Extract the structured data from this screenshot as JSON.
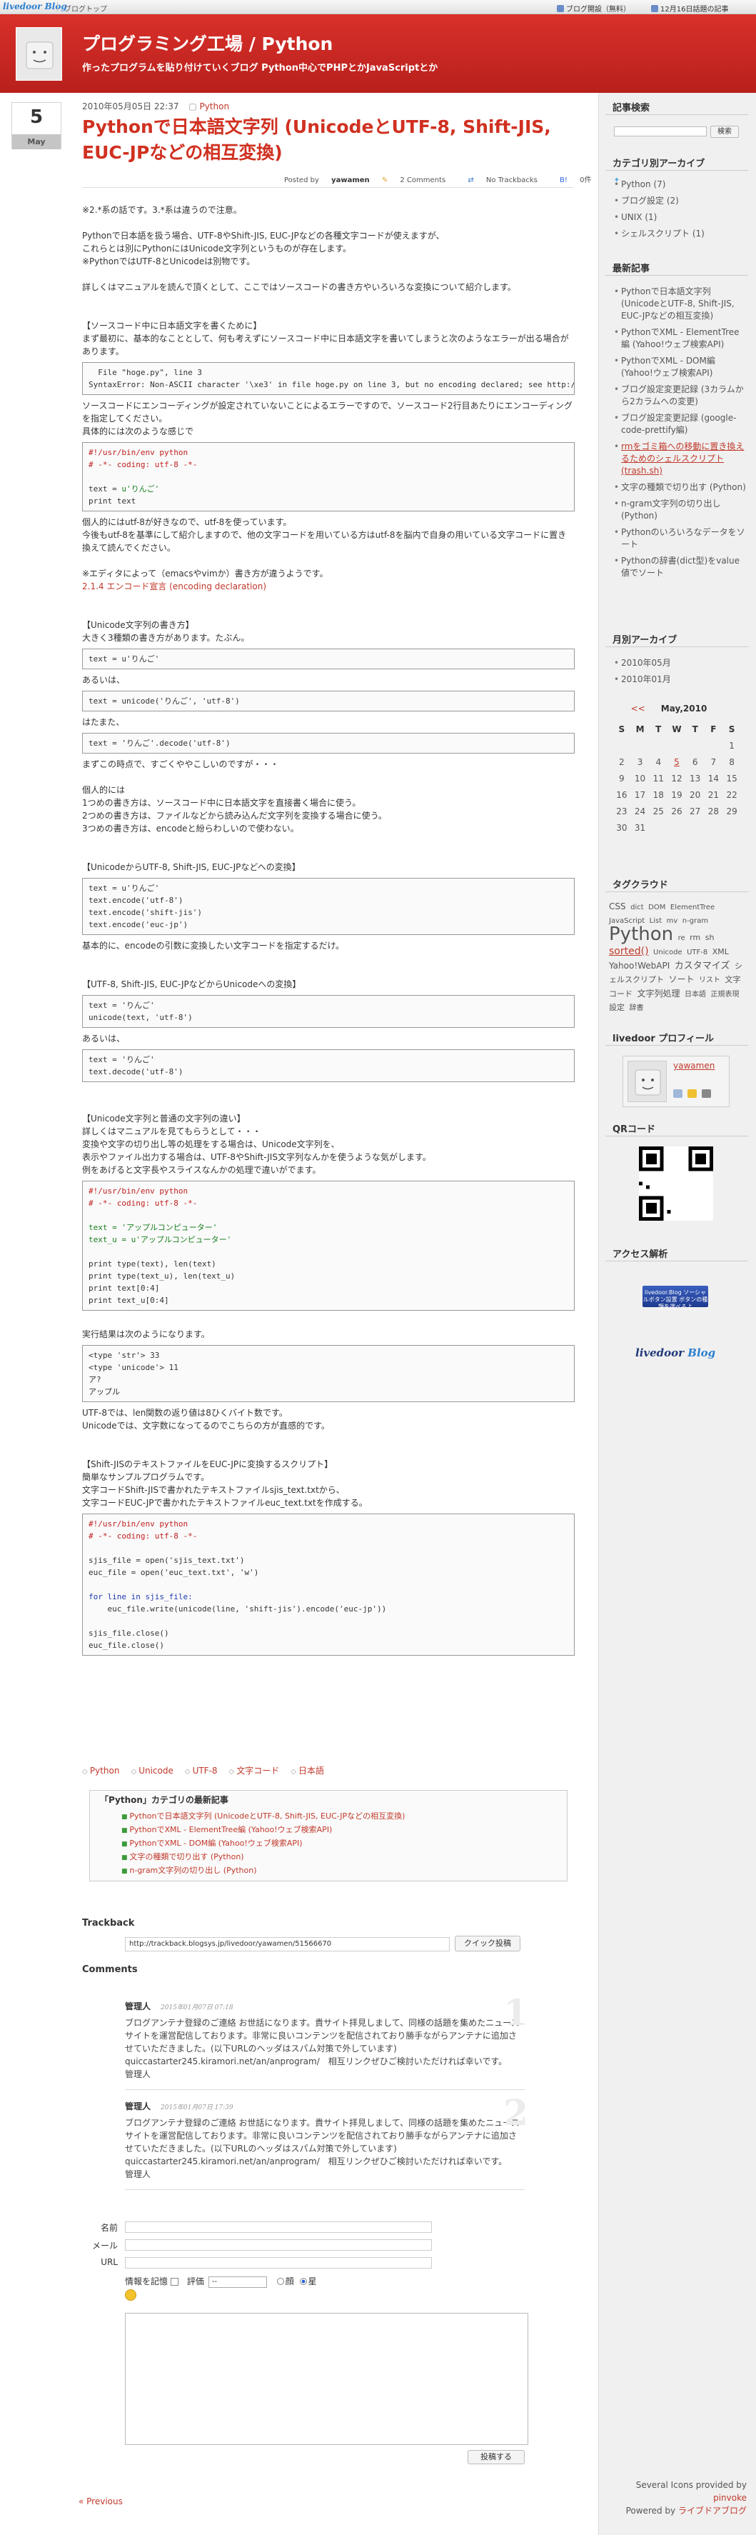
{
  "topbar": {
    "brand_a": "livedoor",
    "brand_b": "Blog",
    "link_left": "ブログトップ",
    "link_signup": "ブログ開設（無料）",
    "link_hot": "12月16日話題の記事"
  },
  "header": {
    "title": "プログラミング工場 / Python",
    "description": "作ったプログラムを貼り付けていくブログ Python中心でPHPとかJavaScriptとか"
  },
  "post": {
    "day": "5",
    "month": "May",
    "datetime": "2010年05月05日 22:37",
    "category": "Python",
    "title": "Pythonで日本語文字列 (UnicodeとUTF-8, Shift-JIS, EUC-JPなどの相互変換)",
    "posted_by_label": "Posted by",
    "author": "yawamen",
    "comments": "2 Comments",
    "trackbacks": "No Trackbacks",
    "users": "0件",
    "intro": "※2.*系の話です。3.*系は違うので注意。\n\nPythonで日本語を扱う場合、UTF-8やShift-JIS, EUC-JPなどの各種文字コードが使えますが、\nこれらとは別にPythonにはUnicode文字列というものが存在します。\n※PythonではUTF-8とUnicodeは別物です。\n\n詳しくはマニュアルを読んで頂くとして、ここではソースコードの書き方やいろいろな変換について紹介します。",
    "s1_head": "【ソースコード中に日本語文字を書くために】\nまず最初に、基本的なこととして、何も考えずにソースコード中に日本語文字を書いてしまうと次のようなエラーが出る場合があります。",
    "s1_code": "  File \"hoge.py\", line 3\nSyntaxError: Non-ASCII character '\\xe3' in file hoge.py on line 3, but no encoding declared; see http://www",
    "s1_mid": "ソースコードにエンコーディングが設定されていないことによるエラーですので、ソースコード2行目あたりにエンコーディングを指定してください。\n具体的には次のような感じで",
    "s1_code2_l1": "#!/usr/bin/env python",
    "s1_code2_l2": "# -*- coding: utf-8 -*-",
    "s1_code2_l3": "text = u'りんご'",
    "s1_code2_l4": "print text",
    "s1_after": "個人的にはutf-8が好きなので、utf-8を使っています。\n今後もutf-8を基準にして紹介しますので、他の文字コードを用いている方はutf-8を脳内で自身の用いている文字コードに置き換えて読んでください。\n\n※エディタによって（emacsやvimか）書き方が違うようです。",
    "s1_link": "2.1.4 エンコード宣言 (encoding declaration)",
    "s2_head": "【Unicode文字列の書き方】\n大きく3種類の書き方があります。たぶん。",
    "s2_code1": "text = u'りんご'",
    "s2_or1": "あるいは、",
    "s2_code2": "text = unicode('りんご', 'utf-8')",
    "s2_or2": "はたまた、",
    "s2_code3": "text = 'りんご'.decode('utf-8')",
    "s2_after": "まずこの時点で、すごくややこしいのですが・・・\n\n個人的には\n1つめの書き方は、ソースコード中に日本語文字を直接書く場合に使う。\n2つめの書き方は、ファイルなどから読み込んだ文字列を変換する場合に使う。\n3つめの書き方は、encodeと紛らわしいので使わない。",
    "s3_head": "【UnicodeからUTF-8, Shift-JIS, EUC-JPなどへの変換】",
    "s3_code_l1": "text = u'りんご'",
    "s3_code_l2": "text.encode('utf-8')",
    "s3_code_l3": "text.encode('shift-jis')",
    "s3_code_l4": "text.encode('euc-jp')",
    "s3_after": "基本的に、encodeの引数に変換したい文字コードを指定するだけ。",
    "s4_head": "【UTF-8, Shift-JIS, EUC-JPなどからUnicodeへの変換】",
    "s4_code1_l1": "text = 'りんご'",
    "s4_code1_l2": "unicode(text, 'utf-8')",
    "s4_or": "あるいは、",
    "s4_code2_l1": "text = 'りんご'",
    "s4_code2_l2": "text.decode('utf-8')",
    "s5_head": "【Unicode文字列と普通の文字列の違い】\n詳しくはマニュアルを見てもらうとして・・・\n変換や文字の切り出し等の処理をする場合は、Unicode文字列を、\n表示やファイル出力する場合は、UTF-8やShift-JIS文字列なんかを使うような気がします。\n例をあげると文字長やスライスなんかの処理で違いがでます。",
    "s5_code_l1": "#!/usr/bin/env python",
    "s5_code_l2": "# -*- coding: utf-8 -*-",
    "s5_code_l3": "text = 'アップルコンピューター'",
    "s5_code_l4": "text_u = u'アップルコンピューター'",
    "s5_code_l5": "print type(text), len(text)",
    "s5_code_l6": "print type(text_u), len(text_u)",
    "s5_code_l7": "print text[0:4]",
    "s5_code_l8": "print text_u[0:4]",
    "s5_result_label": "実行結果は次のようになります。",
    "s5_result": "<type 'str'> 33\n<type 'unicode'> 11\nア?\nアップル",
    "s5_after": "UTF-8では、len関数の返り値は8ひくバイト数です。\nUnicodeでは、文字数になってるのでこちらの方が直感的です。",
    "s6_head": "【Shift-JISのテキストファイルをEUC-JPに変換するスクリプト】\n簡単なサンプルプログラムです。\n文字コードShift-JISで書かれたテキストファイルsjis_text.txtから、\n文字コードEUC-JPで書かれたテキストファイルeuc_text.txtを作成する。",
    "s6_code_l1": "#!/usr/bin/env python",
    "s6_code_l2": "# -*- coding: utf-8 -*-",
    "s6_code_l3": "sjis_file = open('sjis_text.txt')",
    "s6_code_l4": "euc_file = open('euc_text.txt', 'w')",
    "s6_code_l5": "for line in sjis_file:",
    "s6_code_l6": "    euc_file.write(unicode(line, 'shift-jis').encode('euc-jp'))",
    "s6_code_l7": "sjis_file.close()",
    "s6_code_l8": "euc_file.close()"
  },
  "tags": [
    "Python",
    "Unicode",
    "UTF-8",
    "文字コード",
    "日本語"
  ],
  "related": {
    "heading": "「Python」カテゴリの最新記事",
    "items": [
      "Pythonで日本語文字列 (UnicodeとUTF-8, Shift-JIS, EUC-JPなどの相互変換)",
      "PythonでXML - ElementTree編 (Yahoo!ウェブ検索API)",
      "PythonでXML - DOM編 (Yahoo!ウェブ検索API)",
      "文字の種類で切り出す (Python)",
      "n-gram文字列の切り出し (Python)"
    ]
  },
  "trackback": {
    "heading": "Trackback",
    "url": "http://trackback.blogsys.jp/livedoor/yawamen/51566670",
    "button": "クイック投稿"
  },
  "comments": {
    "heading": "Comments",
    "items": [
      {
        "num": "1",
        "name": "管理人",
        "date": "2015年01月07日 07:18",
        "text": "ブログアンテナ登録のご連絡 お世話になります。貴サイト拝見しまして、同様の話題を集めたニュースサイトを運営配信しております。非常に良いコンテンツを配信されており勝手ながらアンテナに追加させていただきました。(以下URLのヘッダはスパム対策で外しています)\nquiccastarter245.kiramori.net/an/anprogram/　相互リンクぜひご検討いただければ幸いです。\n管理人"
      },
      {
        "num": "2",
        "name": "管理人",
        "date": "2015年01月07日 17:39",
        "text": "ブログアンテナ登録のご連絡 お世話になります。貴サイト拝見しまして、同様の話題を集めたニュースサイトを運営配信しております。非常に良いコンテンツを配信されており勝手ながらアンテナに追加させていただきました。(以下URLのヘッダはスパム対策で外しています)\nquiccastarter245.kiramori.net/an/anprogram/　相互リンクぜひご検討いただければ幸いです。\n管理人"
      }
    ]
  },
  "form": {
    "name_label": "名前",
    "email_label": "メール",
    "url_label": "URL",
    "remember_label": "情報を記憶",
    "rating_label": "評価",
    "rating_value": "--",
    "face_good": "顔",
    "face_star": "星",
    "submit": "投稿する"
  },
  "prev_link": "« Previous",
  "sidebar": {
    "search_heading": "記事検索",
    "search_button": "検索",
    "category_heading": "カテゴリ別アーカイブ",
    "categories": [
      "Python (7)",
      "ブログ設定 (2)",
      "UNIX (1)",
      "シェルスクリプト (1)"
    ],
    "recent_heading": "最新記事",
    "recent": [
      "Pythonで日本語文字列 (UnicodeとUTF-8, Shift-JIS, EUC-JPなどの相互変換)",
      "PythonでXML - ElementTree編 (Yahoo!ウェブ検索API)",
      "PythonでXML - DOM編 (Yahoo!ウェブ検索API)",
      "ブログ設定変更記録 (3カラムから2カラムへの変更)",
      "ブログ設定変更記録 (google-code-prettify編)",
      "rmをゴミ箱への移動に置き換えるためのシェルスクリプト (trash.sh)",
      "文字の種類で切り出す (Python)",
      "n-gram文字列の切り出し (Python)",
      "Pythonのいろいろなデータをソート",
      "Pythonの辞書(dict型)をvalue値でソート"
    ],
    "monthly_heading": "月別アーカイブ",
    "months": [
      "2010年05月",
      "2010年01月"
    ],
    "calendar": {
      "prev": "<<",
      "title": "May,2010",
      "days": [
        "S",
        "M",
        "T",
        "W",
        "T",
        "F",
        "S"
      ],
      "weeks": [
        [
          "",
          "",
          "",
          "",
          "",
          "",
          "1"
        ],
        [
          "2",
          "3",
          "4",
          "5",
          "6",
          "7",
          "8"
        ],
        [
          "9",
          "10",
          "11",
          "12",
          "13",
          "14",
          "15"
        ],
        [
          "16",
          "17",
          "18",
          "19",
          "20",
          "21",
          "22"
        ],
        [
          "23",
          "24",
          "25",
          "26",
          "27",
          "28",
          "29"
        ],
        [
          "30",
          "31",
          "",
          "",
          "",
          "",
          ""
        ]
      ],
      "linked": [
        "5"
      ]
    },
    "tagcloud_heading": "タグクラウド",
    "tagcloud": [
      {
        "t": "CSS",
        "s": 12
      },
      {
        "t": "dict",
        "s": 10
      },
      {
        "t": "DOM",
        "s": 10
      },
      {
        "t": "ElementTree",
        "s": 10
      },
      {
        "t": "JavaScript",
        "s": 10
      },
      {
        "t": "List",
        "s": 10
      },
      {
        "t": "mv",
        "s": 10
      },
      {
        "t": "n-gram",
        "s": 10
      },
      {
        "t": "Python",
        "s": 26
      },
      {
        "t": "re",
        "s": 10
      },
      {
        "t": "rm",
        "s": 11
      },
      {
        "t": "sh",
        "s": 11
      },
      {
        "t": "sorted()",
        "s": 14,
        "hl": true
      },
      {
        "t": "Unicode",
        "s": 10
      },
      {
        "t": "UTF-8",
        "s": 10
      },
      {
        "t": "XML",
        "s": 11
      },
      {
        "t": "Yahoo!WebAPI",
        "s": 12
      },
      {
        "t": "カスタマイズ",
        "s": 13
      },
      {
        "t": "シェルスクリプト",
        "s": 11
      },
      {
        "t": "ソート",
        "s": 12
      },
      {
        "t": "リスト",
        "s": 10
      },
      {
        "t": "文字コード",
        "s": 11
      },
      {
        "t": "文字列処理",
        "s": 12
      },
      {
        "t": "日本語",
        "s": 10
      },
      {
        "t": "正規表現",
        "s": 10
      },
      {
        "t": "設定",
        "s": 11
      },
      {
        "t": "辞書",
        "s": 10
      }
    ],
    "profile_heading": "livedoor プロフィール",
    "profile_name": "yawamen",
    "qr_heading": "QRコード",
    "access_heading": "アクセス解析",
    "access_badge": "livedoor.Blog ソーシャルボタン設置 ボタンの種類を選べるよ",
    "rail_logo_a": "livedoor",
    "rail_logo_b": "Blog",
    "credits_line1_a": "Several Icons provided by",
    "credits_line1_b": "pinvoke",
    "credits_line2_a": "Powered by",
    "credits_line2_b": "ライブドアブログ"
  },
  "colors": {
    "header_red": "#c62a22",
    "link_red": "#c0392b",
    "title_red": "#d03020"
  }
}
